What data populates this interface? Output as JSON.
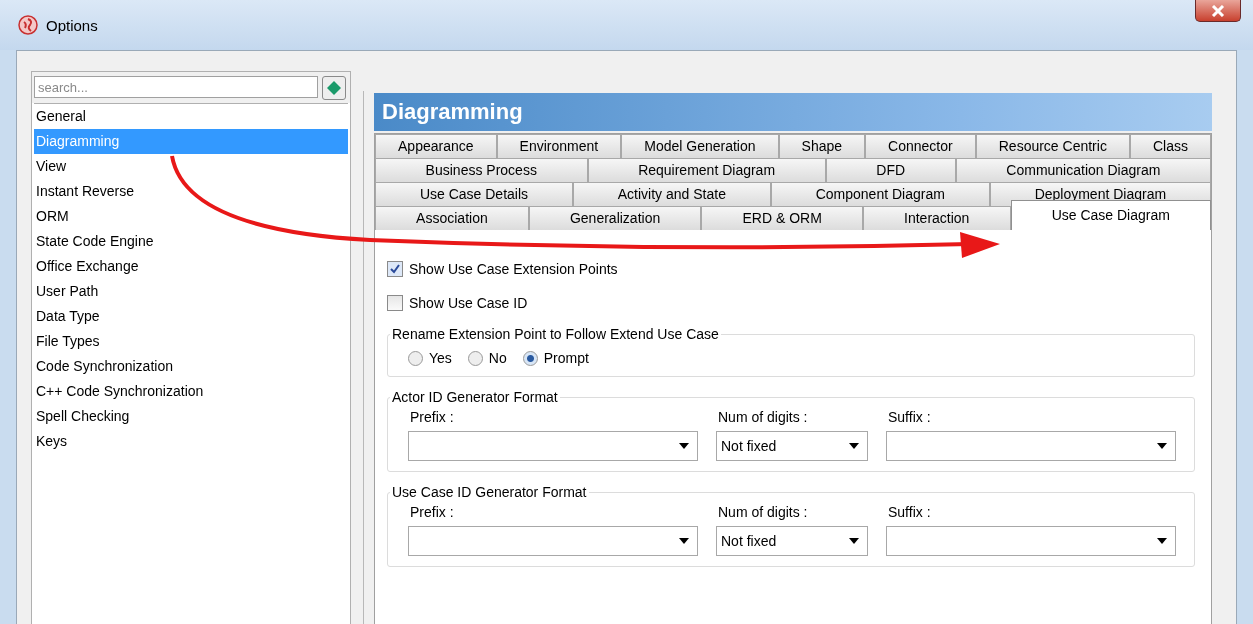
{
  "window": {
    "title": "Options"
  },
  "search": {
    "placeholder": "search..."
  },
  "categories": [
    {
      "label": "General",
      "selected": false
    },
    {
      "label": "Diagramming",
      "selected": true
    },
    {
      "label": "View",
      "selected": false
    },
    {
      "label": "Instant Reverse",
      "selected": false
    },
    {
      "label": "ORM",
      "selected": false
    },
    {
      "label": "State Code Engine",
      "selected": false
    },
    {
      "label": "Office Exchange",
      "selected": false
    },
    {
      "label": "User Path",
      "selected": false
    },
    {
      "label": "Data Type",
      "selected": false
    },
    {
      "label": "File Types",
      "selected": false
    },
    {
      "label": "Code Synchronization",
      "selected": false
    },
    {
      "label": "C++ Code Synchronization",
      "selected": false
    },
    {
      "label": "Spell Checking",
      "selected": false
    },
    {
      "label": "Keys",
      "selected": false
    }
  ],
  "header": "Diagramming",
  "tab_rows": [
    [
      {
        "label": "Appearance",
        "selected": false
      },
      {
        "label": "Environment",
        "selected": false
      },
      {
        "label": "Model Generation",
        "selected": false
      },
      {
        "label": "Shape",
        "selected": false
      },
      {
        "label": "Connector",
        "selected": false
      },
      {
        "label": "Resource Centric",
        "selected": false
      },
      {
        "label": "Class",
        "selected": false
      }
    ],
    [
      {
        "label": "Business Process",
        "selected": false
      },
      {
        "label": "Requirement Diagram",
        "selected": false
      },
      {
        "label": "DFD",
        "selected": false
      },
      {
        "label": "Communication Diagram",
        "selected": false
      }
    ],
    [
      {
        "label": "Use Case Details",
        "selected": false
      },
      {
        "label": "Activity and State",
        "selected": false
      },
      {
        "label": "Component Diagram",
        "selected": false
      },
      {
        "label": "Deployment Diagram",
        "selected": false
      }
    ],
    [
      {
        "label": "Association",
        "selected": false
      },
      {
        "label": "Generalization",
        "selected": false
      },
      {
        "label": "ERD & ORM",
        "selected": false
      },
      {
        "label": "Interaction",
        "selected": false
      },
      {
        "label": "Use Case Diagram",
        "selected": true
      }
    ]
  ],
  "checkboxes": [
    {
      "label": "Show Use Case Extension Points",
      "checked": true
    },
    {
      "label": "Show Use Case ID",
      "checked": false
    }
  ],
  "rename_group": {
    "title": "Rename Extension Point to Follow Extend Use Case",
    "options": [
      {
        "label": "Yes",
        "selected": false
      },
      {
        "label": "No",
        "selected": false
      },
      {
        "label": "Prompt",
        "selected": true
      }
    ]
  },
  "id_formats": [
    {
      "title": "Actor ID Generator Format",
      "fields": [
        {
          "label": "Prefix :"
        },
        {
          "label": "Num of digits :",
          "value": "Not fixed"
        },
        {
          "label": "Suffix :"
        }
      ]
    },
    {
      "title": "Use Case ID Generator Format",
      "fields": [
        {
          "label": "Prefix :"
        },
        {
          "label": "Num of digits :",
          "value": "Not fixed"
        },
        {
          "label": "Suffix :"
        }
      ]
    }
  ]
}
